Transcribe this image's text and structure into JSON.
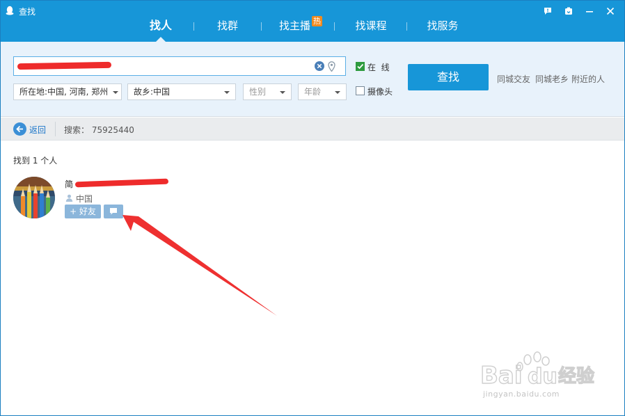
{
  "window": {
    "title": "查找",
    "controls": [
      "feedback-icon",
      "skin-icon",
      "minimize-icon",
      "close-icon"
    ]
  },
  "tabs": [
    {
      "label": "找人",
      "active": true
    },
    {
      "label": "找群",
      "active": false
    },
    {
      "label": "找主播",
      "active": false,
      "badge": "热"
    },
    {
      "label": "找课程",
      "active": false
    },
    {
      "label": "找服务",
      "active": false
    }
  ],
  "search": {
    "clear_icon": "clear-icon",
    "location_icon": "location-pin-icon",
    "filters": {
      "location": "所在地:中国, 河南, 郑州",
      "hometown": "故乡:中国",
      "gender": "性别",
      "age": "年龄"
    },
    "online": {
      "label": "在  线",
      "checked": true
    },
    "camera": {
      "label": "摄像头",
      "checked": false
    },
    "find_button": "查找",
    "quick_links": [
      "同城交友",
      "同城老乡",
      "附近的人"
    ]
  },
  "nav": {
    "back_label": "返回",
    "search_info": "搜索： 75925440"
  },
  "results": {
    "count_text": "找到 1 个人",
    "items": [
      {
        "name_visible": "简",
        "location": "中国",
        "add_friend_label": "+ 好友",
        "message_icon": "chat-bubble-icon"
      }
    ]
  },
  "colors": {
    "primary": "#1796d8",
    "panel": "#e8f2fb",
    "hot_badge": "#f18a1f",
    "action_button": "#8bb6db",
    "annotation_red": "#ee2b2b"
  },
  "watermark": {
    "brand": "Bai",
    "brand_du": "du",
    "brand_cn": "经验",
    "url": "jingyan.baidu.com"
  }
}
